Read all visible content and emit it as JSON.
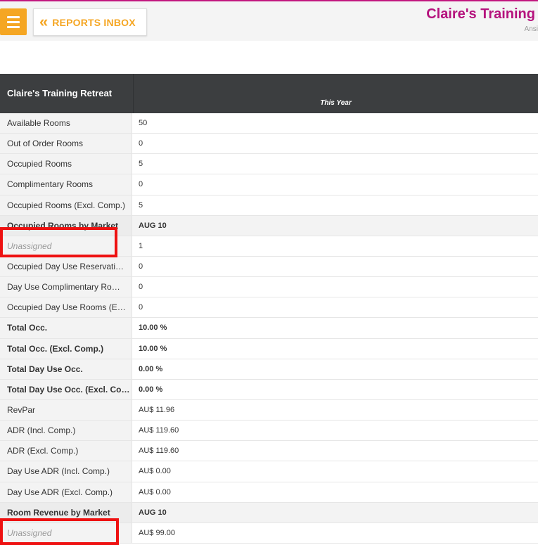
{
  "topbar": {
    "menu_icon": "hamburger-icon",
    "reports_inbox_label": "REPORTS INBOX",
    "back_icon": "double-chevron-left-icon",
    "property_title": "Claire's Training",
    "property_subtitle": "Ansi"
  },
  "report": {
    "property_name": "Claire's Training Retreat",
    "period_label": "This Year",
    "rows": [
      {
        "label": "Available Rooms",
        "value": "50"
      },
      {
        "label": "Out of Order Rooms",
        "value": "0"
      },
      {
        "label": "Occupied Rooms",
        "value": "5"
      },
      {
        "label": "Complimentary Rooms",
        "value": "0"
      },
      {
        "label": "Occupied Rooms (Excl. Comp.)",
        "value": "5"
      },
      {
        "label": "Occupied Rooms by Market",
        "value": "AUG 10"
      },
      {
        "label": "Unassigned",
        "value": "1"
      },
      {
        "label": "Occupied Day Use Reservati…",
        "value": "0"
      },
      {
        "label": "Day Use Complimentary Ro…",
        "value": "0"
      },
      {
        "label": "Occupied Day Use Rooms (E…",
        "value": "0"
      },
      {
        "label": "Total Occ.",
        "value": "10.00 %"
      },
      {
        "label": "Total Occ. (Excl. Comp.)",
        "value": "10.00 %"
      },
      {
        "label": "Total Day Use Occ.",
        "value": "0.00 %"
      },
      {
        "label": "Total Day Use Occ. (Excl. Co…",
        "value": "0.00 %"
      },
      {
        "label": "RevPar",
        "value": "AU$ 11.96"
      },
      {
        "label": "ADR (Incl. Comp.)",
        "value": "AU$ 119.60"
      },
      {
        "label": "ADR (Excl. Comp.)",
        "value": "AU$ 119.60"
      },
      {
        "label": "Day Use ADR (Incl. Comp.)",
        "value": "AU$ 0.00"
      },
      {
        "label": "Day Use ADR (Excl. Comp.)",
        "value": "AU$ 0.00"
      },
      {
        "label": "Room Revenue by Market",
        "value": "AUG 10"
      },
      {
        "label": "Unassigned",
        "value": "AU$ 99.00"
      }
    ]
  },
  "colors": {
    "accent_orange": "#f5a623",
    "brand_magenta": "#b5127d",
    "header_dark": "#3c3e40",
    "highlight_red": "#ee1111"
  }
}
